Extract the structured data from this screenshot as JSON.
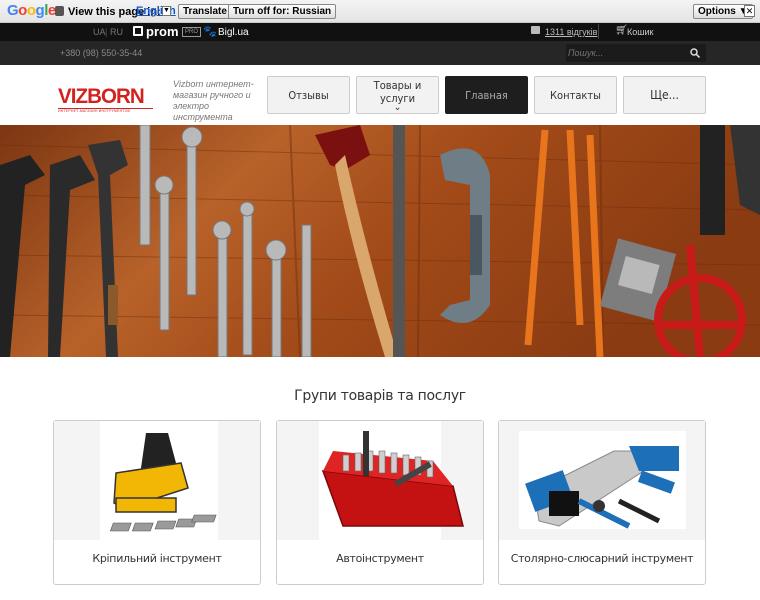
{
  "translate_bar": {
    "logo": "Google",
    "view_text": "View this page in:",
    "language": "English",
    "translate_label": "Translate",
    "turn_off_label": "Turn off for: Russian",
    "options_label": "Options ▼",
    "close_label": "✕"
  },
  "topbar": {
    "lang_uk": "UA",
    "lang_ru": "RU",
    "prom_label": "prom",
    "pro_badge": "PRO",
    "bigl_label": "Bigl.ua",
    "reviews_label": "1311 відгуків",
    "cart_label": "Кошик"
  },
  "subbar": {
    "phone": "+380 (98) 550-35-44",
    "search_placeholder": "Пошук..."
  },
  "header": {
    "logo_text": "VIZBORN",
    "logo_sub": "ИНТЕРНЕТ-МАГАЗИН ИНСТРУМЕНТОВ",
    "tagline": "Vizborn интернет-магазин ручного и электро инструмента",
    "nav": [
      {
        "label": "Отзывы"
      },
      {
        "label": "Товары и услуги"
      },
      {
        "label": "Главная"
      },
      {
        "label": "Контакты"
      },
      {
        "label": "Ще..."
      }
    ],
    "dropdown_glyph": "⌄"
  },
  "section": {
    "title": "Групи товарів та послуг",
    "cards": [
      {
        "label": "Кріпильний інструмент"
      },
      {
        "label": "Автоінструмент"
      },
      {
        "label": "Столярно-слюсарний інструмент"
      }
    ]
  },
  "colors": {
    "active_nav_bg": "#1e1e1e",
    "logo_red": "#d3231f",
    "wood": "#a9501e"
  }
}
